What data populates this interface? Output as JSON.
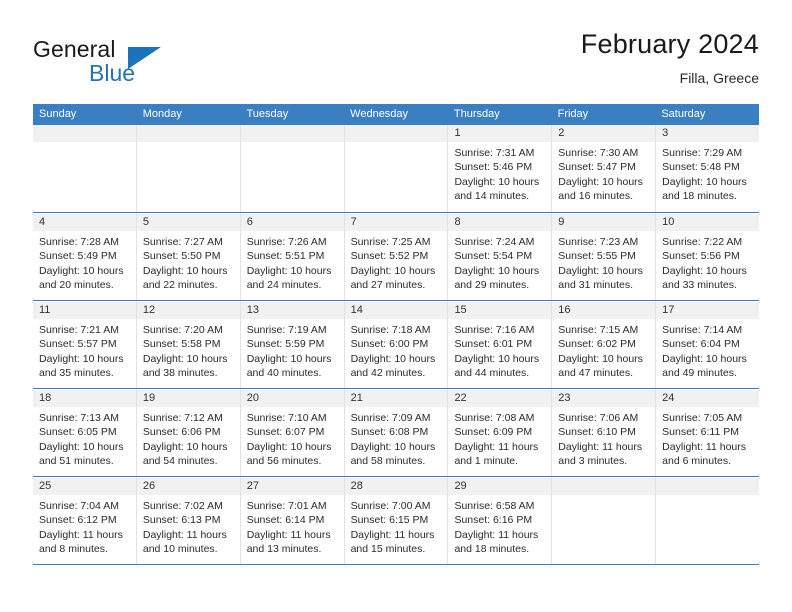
{
  "brand": {
    "word1": "General",
    "word2": "Blue",
    "flag_icon": "triangle-flag-icon"
  },
  "header": {
    "title": "February 2024",
    "subtitle": "Filla, Greece"
  },
  "colors": {
    "header_blue": "#3a7fc1",
    "brand_blue": "#2572b8",
    "flag_blue": "#1b74bb",
    "day_number_band": "#f1f1f1",
    "cell_border": "#e2e2e2",
    "text": "#2b2b2b"
  },
  "weekdays": [
    "Sunday",
    "Monday",
    "Tuesday",
    "Wednesday",
    "Thursday",
    "Friday",
    "Saturday"
  ],
  "weeks": [
    [
      {
        "day": "",
        "lines": []
      },
      {
        "day": "",
        "lines": []
      },
      {
        "day": "",
        "lines": []
      },
      {
        "day": "",
        "lines": []
      },
      {
        "day": "1",
        "lines": [
          "Sunrise: 7:31 AM",
          "Sunset: 5:46 PM",
          "Daylight: 10 hours",
          "and 14 minutes."
        ]
      },
      {
        "day": "2",
        "lines": [
          "Sunrise: 7:30 AM",
          "Sunset: 5:47 PM",
          "Daylight: 10 hours",
          "and 16 minutes."
        ]
      },
      {
        "day": "3",
        "lines": [
          "Sunrise: 7:29 AM",
          "Sunset: 5:48 PM",
          "Daylight: 10 hours",
          "and 18 minutes."
        ]
      }
    ],
    [
      {
        "day": "4",
        "lines": [
          "Sunrise: 7:28 AM",
          "Sunset: 5:49 PM",
          "Daylight: 10 hours",
          "and 20 minutes."
        ]
      },
      {
        "day": "5",
        "lines": [
          "Sunrise: 7:27 AM",
          "Sunset: 5:50 PM",
          "Daylight: 10 hours",
          "and 22 minutes."
        ]
      },
      {
        "day": "6",
        "lines": [
          "Sunrise: 7:26 AM",
          "Sunset: 5:51 PM",
          "Daylight: 10 hours",
          "and 24 minutes."
        ]
      },
      {
        "day": "7",
        "lines": [
          "Sunrise: 7:25 AM",
          "Sunset: 5:52 PM",
          "Daylight: 10 hours",
          "and 27 minutes."
        ]
      },
      {
        "day": "8",
        "lines": [
          "Sunrise: 7:24 AM",
          "Sunset: 5:54 PM",
          "Daylight: 10 hours",
          "and 29 minutes."
        ]
      },
      {
        "day": "9",
        "lines": [
          "Sunrise: 7:23 AM",
          "Sunset: 5:55 PM",
          "Daylight: 10 hours",
          "and 31 minutes."
        ]
      },
      {
        "day": "10",
        "lines": [
          "Sunrise: 7:22 AM",
          "Sunset: 5:56 PM",
          "Daylight: 10 hours",
          "and 33 minutes."
        ]
      }
    ],
    [
      {
        "day": "11",
        "lines": [
          "Sunrise: 7:21 AM",
          "Sunset: 5:57 PM",
          "Daylight: 10 hours",
          "and 35 minutes."
        ]
      },
      {
        "day": "12",
        "lines": [
          "Sunrise: 7:20 AM",
          "Sunset: 5:58 PM",
          "Daylight: 10 hours",
          "and 38 minutes."
        ]
      },
      {
        "day": "13",
        "lines": [
          "Sunrise: 7:19 AM",
          "Sunset: 5:59 PM",
          "Daylight: 10 hours",
          "and 40 minutes."
        ]
      },
      {
        "day": "14",
        "lines": [
          "Sunrise: 7:18 AM",
          "Sunset: 6:00 PM",
          "Daylight: 10 hours",
          "and 42 minutes."
        ]
      },
      {
        "day": "15",
        "lines": [
          "Sunrise: 7:16 AM",
          "Sunset: 6:01 PM",
          "Daylight: 10 hours",
          "and 44 minutes."
        ]
      },
      {
        "day": "16",
        "lines": [
          "Sunrise: 7:15 AM",
          "Sunset: 6:02 PM",
          "Daylight: 10 hours",
          "and 47 minutes."
        ]
      },
      {
        "day": "17",
        "lines": [
          "Sunrise: 7:14 AM",
          "Sunset: 6:04 PM",
          "Daylight: 10 hours",
          "and 49 minutes."
        ]
      }
    ],
    [
      {
        "day": "18",
        "lines": [
          "Sunrise: 7:13 AM",
          "Sunset: 6:05 PM",
          "Daylight: 10 hours",
          "and 51 minutes."
        ]
      },
      {
        "day": "19",
        "lines": [
          "Sunrise: 7:12 AM",
          "Sunset: 6:06 PM",
          "Daylight: 10 hours",
          "and 54 minutes."
        ]
      },
      {
        "day": "20",
        "lines": [
          "Sunrise: 7:10 AM",
          "Sunset: 6:07 PM",
          "Daylight: 10 hours",
          "and 56 minutes."
        ]
      },
      {
        "day": "21",
        "lines": [
          "Sunrise: 7:09 AM",
          "Sunset: 6:08 PM",
          "Daylight: 10 hours",
          "and 58 minutes."
        ]
      },
      {
        "day": "22",
        "lines": [
          "Sunrise: 7:08 AM",
          "Sunset: 6:09 PM",
          "Daylight: 11 hours",
          "and 1 minute."
        ]
      },
      {
        "day": "23",
        "lines": [
          "Sunrise: 7:06 AM",
          "Sunset: 6:10 PM",
          "Daylight: 11 hours",
          "and 3 minutes."
        ]
      },
      {
        "day": "24",
        "lines": [
          "Sunrise: 7:05 AM",
          "Sunset: 6:11 PM",
          "Daylight: 11 hours",
          "and 6 minutes."
        ]
      }
    ],
    [
      {
        "day": "25",
        "lines": [
          "Sunrise: 7:04 AM",
          "Sunset: 6:12 PM",
          "Daylight: 11 hours",
          "and 8 minutes."
        ]
      },
      {
        "day": "26",
        "lines": [
          "Sunrise: 7:02 AM",
          "Sunset: 6:13 PM",
          "Daylight: 11 hours",
          "and 10 minutes."
        ]
      },
      {
        "day": "27",
        "lines": [
          "Sunrise: 7:01 AM",
          "Sunset: 6:14 PM",
          "Daylight: 11 hours",
          "and 13 minutes."
        ]
      },
      {
        "day": "28",
        "lines": [
          "Sunrise: 7:00 AM",
          "Sunset: 6:15 PM",
          "Daylight: 11 hours",
          "and 15 minutes."
        ]
      },
      {
        "day": "29",
        "lines": [
          "Sunrise: 6:58 AM",
          "Sunset: 6:16 PM",
          "Daylight: 11 hours",
          "and 18 minutes."
        ]
      },
      {
        "day": "",
        "lines": []
      },
      {
        "day": "",
        "lines": []
      }
    ]
  ]
}
